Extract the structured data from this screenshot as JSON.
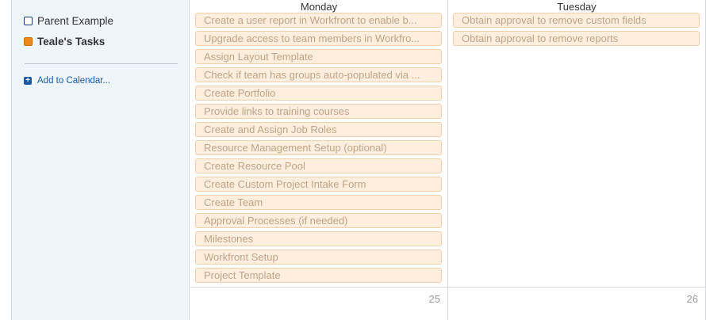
{
  "sidebar": {
    "calendars": [
      {
        "label": "Parent Example"
      },
      {
        "label": "Teale's Tasks"
      }
    ],
    "add_calendar_label": "Add to Calendar..."
  },
  "days": [
    {
      "name": "Monday",
      "date": "25",
      "tasks": [
        "Create a user report in Workfront to enable b...",
        "Upgrade access to team members in Workfro...",
        "Assign Layout Template",
        "Check if team has groups auto-populated via ...",
        "Create Portfolio",
        "Provide links to training courses",
        "Create and Assign Job Roles",
        "Resource Management Setup (optional)",
        "Create Resource Pool",
        "Create Custom Project Intake Form",
        "Create Team",
        "Approval Processes (if needed)",
        "Milestones",
        "Workfront Setup",
        "Project Template"
      ]
    },
    {
      "name": "Tuesday",
      "date": "26",
      "tasks": [
        "Obtain approval to remove custom fields",
        "Obtain approval to remove reports"
      ]
    }
  ],
  "colors": {
    "teale_swatch": "#e8891a",
    "parent_swatch_border": "#1e3a6e",
    "task_bg": "#fdeedd",
    "task_text": "#bfa38a",
    "sidebar_bg": "#eef6fc",
    "link": "#1d5aa5"
  }
}
